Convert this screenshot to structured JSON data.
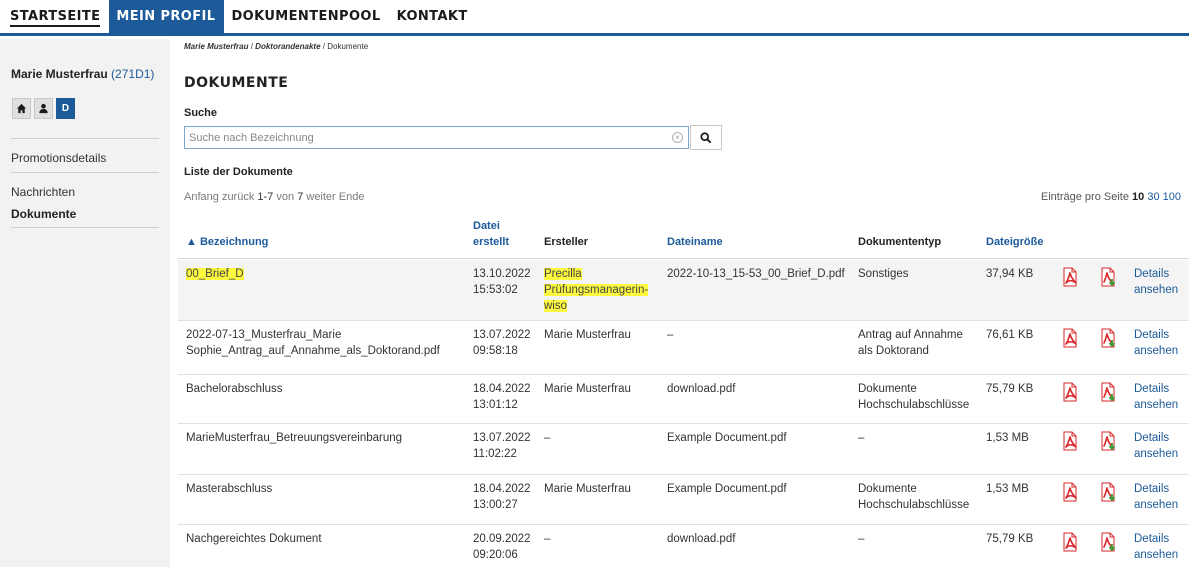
{
  "nav": {
    "items": [
      {
        "label": "STARTSEITE"
      },
      {
        "label": "MEIN PROFIL"
      },
      {
        "label": "DOKUMENTENPOOL"
      },
      {
        "label": "KONTAKT"
      }
    ]
  },
  "sidebar": {
    "user_name": "Marie Musterfrau",
    "user_id": "(271D1)",
    "icon_buttons": [
      {
        "icon": "home-icon"
      },
      {
        "icon": "person-icon"
      },
      {
        "label": "D"
      }
    ],
    "links": [
      {
        "label": "Promotionsdetails"
      },
      {
        "label": "Nachrichten"
      },
      {
        "label": "Dokumente"
      }
    ]
  },
  "breadcrumb": {
    "items": [
      "Marie Musterfrau",
      "Doktorandenakte",
      "Dokumente"
    ],
    "separator": "/"
  },
  "page": {
    "title": "DOKUMENTE",
    "search_label": "Suche",
    "search_placeholder": "Suche nach Bezeichnung",
    "search_value": "",
    "list_label": "Liste der Dokumente"
  },
  "pager": {
    "first": "Anfang",
    "prev": "zurück",
    "range": "1-7",
    "of_word": "von",
    "total": "7",
    "next": "weiter",
    "last": "Ende",
    "per_page_label": "Einträge pro Seite",
    "per_page_options": [
      "10",
      "30",
      "100"
    ],
    "per_page_current": "10"
  },
  "table": {
    "headers": {
      "bezeichnung": "Bezeichnung",
      "datei_erstellt_1": "Datei",
      "datei_erstellt_2": "erstellt",
      "ersteller": "Ersteller",
      "dateiname": "Dateiname",
      "dokumententyp": "Dokumententyp",
      "dateigroesse": "Dateigröße"
    },
    "sort_indicator": "▲",
    "details_line1": "Details",
    "details_line2": "ansehen",
    "rows": [
      {
        "bezeichnung": [
          "00_Brief_D"
        ],
        "datum": "13.10.2022",
        "zeit": "15:53:02",
        "ersteller": [
          "Precilla",
          "Prüfungsmanagerin-",
          "wiso"
        ],
        "dateiname": "2022-10-13_15-53_00_Brief_D.pdf",
        "dokumententyp": [
          "Sonstiges"
        ],
        "groesse": "37,94 KB"
      },
      {
        "bezeichnung": [
          "2022-07-13_Musterfrau_Marie",
          "Sophie_Antrag_auf_Annahme_als_Doktorand.pdf"
        ],
        "datum": "13.07.2022",
        "zeit": "09:58:18",
        "ersteller": [
          "Marie Musterfrau"
        ],
        "dateiname": "–",
        "dokumententyp": [
          "Antrag auf Annahme",
          "als Doktorand"
        ],
        "groesse": "76,61 KB"
      },
      {
        "bezeichnung": [
          "Bachelorabschluss"
        ],
        "datum": "18.04.2022",
        "zeit": "13:01:12",
        "ersteller": [
          "Marie Musterfrau"
        ],
        "dateiname": "download.pdf",
        "dokumententyp": [
          "Dokumente",
          "Hochschulabschlüsse"
        ],
        "groesse": "75,79 KB"
      },
      {
        "bezeichnung": [
          "MarieMusterfrau_Betreuungsvereinbarung"
        ],
        "datum": "13.07.2022",
        "zeit": "11:02:22",
        "ersteller": [
          "–"
        ],
        "dateiname": "Example Document.pdf",
        "dokumententyp": [
          "–"
        ],
        "groesse": "1,53 MB"
      },
      {
        "bezeichnung": [
          "Masterabschluss"
        ],
        "datum": "18.04.2022",
        "zeit": "13:00:27",
        "ersteller": [
          "Marie Musterfrau"
        ],
        "dateiname": "Example Document.pdf",
        "dokumententyp": [
          "Dokumente",
          "Hochschulabschlüsse"
        ],
        "groesse": "1,53 MB"
      },
      {
        "bezeichnung": [
          "Nachgereichtes Dokument"
        ],
        "datum": "20.09.2022",
        "zeit": "09:20:06",
        "ersteller": [
          "–"
        ],
        "dateiname": "download.pdf",
        "dokumententyp": [
          "–"
        ],
        "groesse": "75,79 KB"
      }
    ]
  },
  "colors": {
    "primary": "#1c5a9a",
    "highlight": "#fdf93f",
    "pdf_red": "#d8262b",
    "download_green": "#3c9a35"
  }
}
